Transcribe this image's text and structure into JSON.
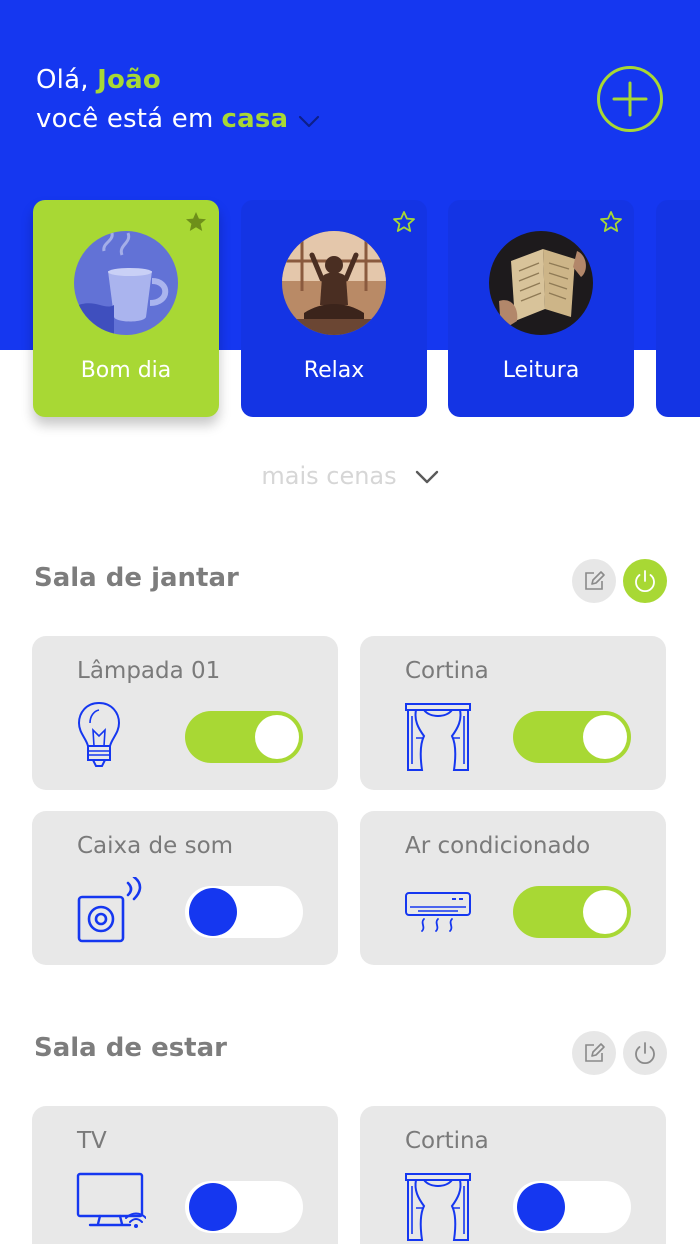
{
  "header": {
    "greeting_prefix": "Olá,",
    "user_name": "João",
    "location_prefix": "você está em",
    "location": "casa"
  },
  "scenes": [
    {
      "label": "Bom dia",
      "favorite": true,
      "active": true,
      "icon": "coffee-photo"
    },
    {
      "label": "Relax",
      "favorite": false,
      "active": false,
      "icon": "meditation-photo"
    },
    {
      "label": "Leitura",
      "favorite": false,
      "active": false,
      "icon": "reading-photo"
    }
  ],
  "more_scenes": {
    "label": "mais cenas"
  },
  "rooms": [
    {
      "name": "Sala de jantar",
      "power_on": true,
      "devices": [
        {
          "label": "Lâmpada 01",
          "icon": "lightbulb-icon",
          "on": true
        },
        {
          "label": "Cortina",
          "icon": "curtain-icon",
          "on": true
        },
        {
          "label": "Caixa de som",
          "icon": "speaker-icon",
          "on": false
        },
        {
          "label": "Ar condicionado",
          "icon": "air-conditioner-icon",
          "on": true
        }
      ]
    },
    {
      "name": "Sala de estar",
      "power_on": false,
      "devices": [
        {
          "label": "TV",
          "icon": "tv-icon",
          "on": false
        },
        {
          "label": "Cortina",
          "icon": "curtain-icon",
          "on": false
        }
      ]
    }
  ],
  "colors": {
    "primary": "#1537f0",
    "accent": "#a8d834",
    "card": "#e8e8e8",
    "text_muted": "#7a7a7a"
  }
}
